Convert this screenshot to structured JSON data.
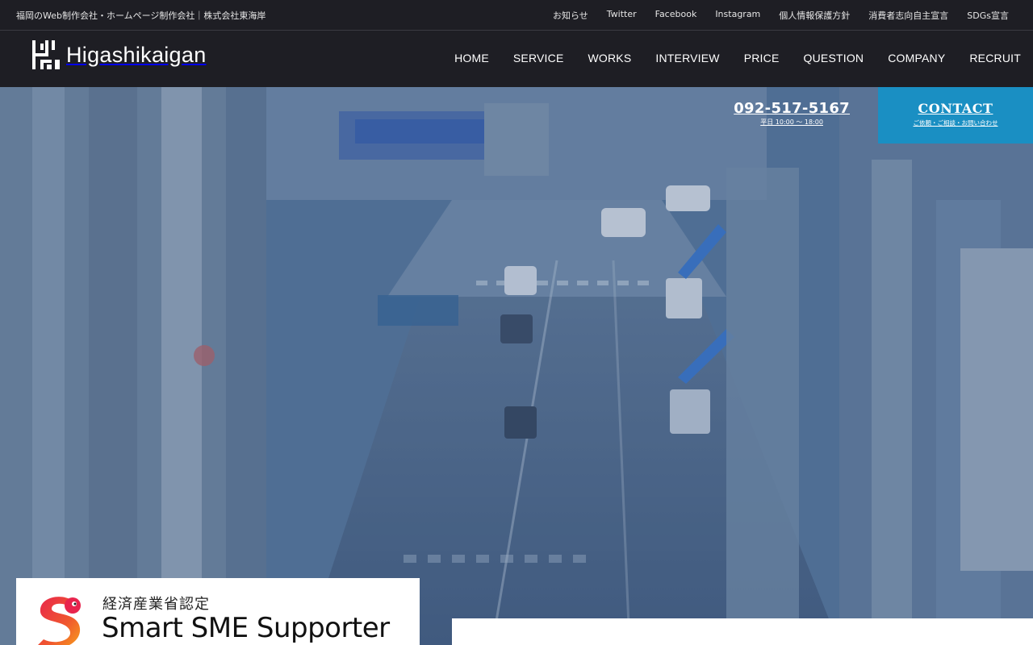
{
  "topbar": {
    "tagline": "福岡のWeb制作会社・ホームページ制作会社｜株式会社東海岸",
    "links": [
      "お知らせ",
      "Twitter",
      "Facebook",
      "Instagram",
      "個人情報保護方針",
      "消費者志向自主宣言",
      "SDGs宣言"
    ]
  },
  "header": {
    "logo_text": "Higashikaigan",
    "nav": [
      "HOME",
      "SERVICE",
      "WORKS",
      "INTERVIEW",
      "PRICE",
      "QUESTION",
      "COMPANY",
      "RECRUIT"
    ]
  },
  "hero": {
    "phone_number": "092-517-5167",
    "phone_hours": "平日 10:00 〜 18:00",
    "contact_title": "CONTACT",
    "contact_sub": "ご依頼・ご相談・お問い合わせ"
  },
  "badge": {
    "line1": "経済産業省認定",
    "line2": "Smart SME Supporter"
  },
  "colors": {
    "dark_bg": "#1e1e24",
    "contact_blue": "#1a8fc3",
    "hero_tint": "#4d6a8f"
  }
}
